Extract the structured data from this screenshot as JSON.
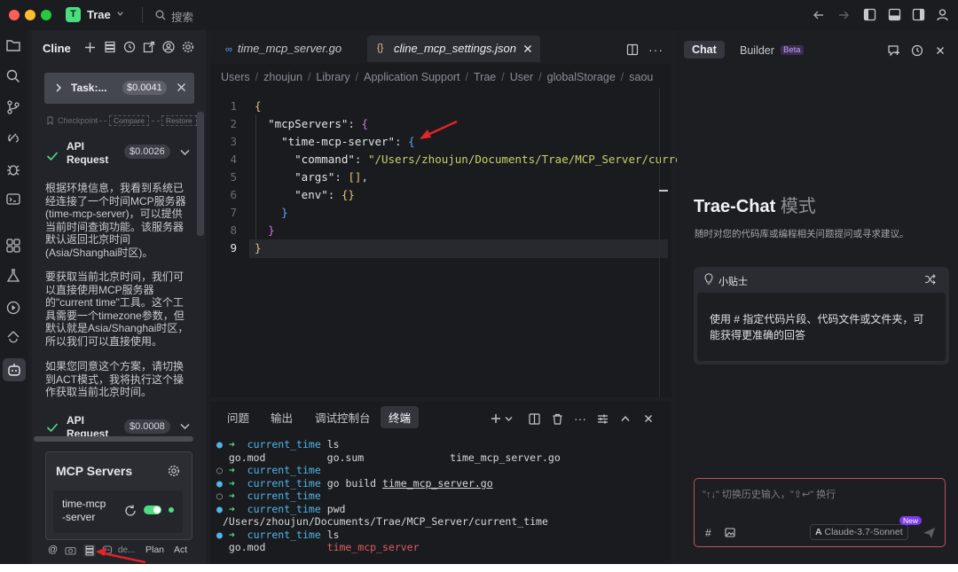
{
  "app": {
    "name": "Trae",
    "search_label": "搜索",
    "logo_letter": "T",
    "accent": "#4ade80"
  },
  "cline": {
    "title": "Cline",
    "task": {
      "label": "Task:...",
      "cost": "$0.0041"
    },
    "checkpoint": {
      "label": "Checkpoint",
      "compare": "Compare",
      "restore": "Restore"
    },
    "api_requests": [
      {
        "label_line1": "API",
        "label_line2": "Request",
        "cost": "$0.0026"
      },
      {
        "label_line1": "API",
        "label_line2": "Request",
        "cost": "$0.0008"
      }
    ],
    "paragraphs": [
      [
        "根据环境信息，我看到系统已",
        "经连接了一个时间MCP服务器",
        "(time-mcp-server)，可以提供",
        "当前时间查询功能。该服务器",
        "默认返回北京时间",
        "(Asia/Shanghai时区)。"
      ],
      [
        "要获取当前北京时间，我们可",
        "以直接使用MCP服务器",
        "的\"current time\"工具。这个工",
        "具需要一个timezone参数，但",
        "默认就是Asia/Shanghai时区，",
        "所以我们可以直接使用。"
      ],
      [
        "如果您同意这个方案，请切换",
        "到ACT模式，我将执行这个操",
        "作获取当前北京时间。"
      ]
    ],
    "mcp": {
      "title": "MCP Servers",
      "server_line1": "time-mcp",
      "server_line2": "-server"
    },
    "bottom": {
      "at": "@",
      "de": "de...",
      "plan": "Plan",
      "act": "Act"
    }
  },
  "editor": {
    "tabs": [
      {
        "label": "time_mcp_server.go",
        "icon": "go-file-icon",
        "active": false
      },
      {
        "label": "cline_mcp_settings.json",
        "icon": "json-file-icon",
        "active": true
      }
    ],
    "breadcrumb": [
      "Users",
      "zhoujun",
      "Library",
      "Application Support",
      "Trae",
      "User",
      "globalStorage",
      "saou"
    ],
    "line_numbers": [
      "1",
      "2",
      "3",
      "4",
      "5",
      "6",
      "7",
      "8",
      "9"
    ],
    "code": {
      "mcpServers": "\"mcpServers\"",
      "server": "\"time-mcp-server\"",
      "command_key": "\"command\"",
      "command_val": "\"/Users/zhoujun/Documents/Trae/MCP_Server/curren",
      "args_key": "\"args\"",
      "env_key": "\"env\""
    }
  },
  "terminal": {
    "tabs": [
      "问题",
      "输出",
      "调试控制台",
      "终端"
    ],
    "lines": {
      "l1_dir": "current_time",
      "l1_cmd": "ls",
      "l2_a": "go.mod",
      "l2_b": "go.sum",
      "l2_c": "time_mcp_server.go",
      "l3_dir": "current_time",
      "l4_dir": "current_time",
      "l4_cmd": "go build",
      "l4_file": "time_mcp_server.go",
      "l5_dir": "current_time",
      "l6_dir": "current_time",
      "l6_cmd": "pwd",
      "l7": "/Users/zhoujun/Documents/Trae/MCP_Server/current_time",
      "l8_dir": "current_time",
      "l8_cmd": "ls",
      "l9_a": "go.mod",
      "l9_b": "time_mcp_server"
    }
  },
  "chat": {
    "tab_chat": "Chat",
    "tab_builder": "Builder",
    "beta": "Beta",
    "hero_title": "Trae-Chat",
    "hero_mode": "模式",
    "hero_sub": "随时对您的代码库或编程相关问题提问或寻求建议。",
    "tip_title": "小贴士",
    "tip_body_1": "使用 # 指定代码片段、代码文件或文件夹，可",
    "tip_body_2": "能获得更准确的回答",
    "input_placeholder": "\"↑↓\" 切换历史输入，\"⇧↩\" 换行",
    "model": "Claude-3.7-Sonnet",
    "new_badge": "New"
  }
}
